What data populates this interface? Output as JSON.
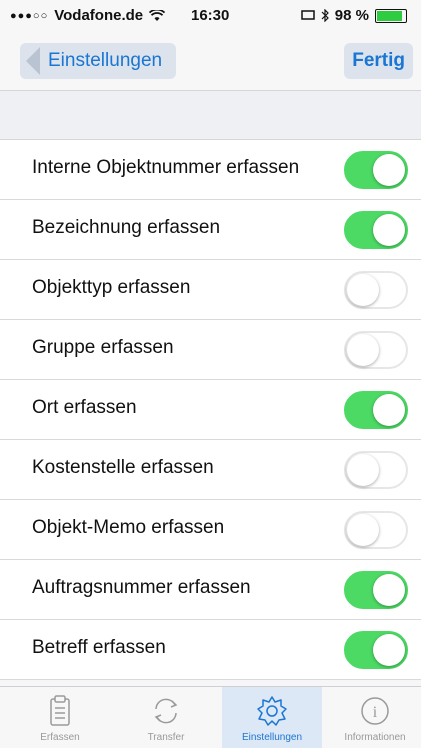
{
  "status_bar": {
    "signal": "●●●○○",
    "carrier": "Vodafone.de",
    "wifi_icon": "wifi-icon",
    "time": "16:30",
    "bluetooth_icon": "bluetooth-icon",
    "battery_percent_text": "98 %",
    "battery_level": 0.98
  },
  "nav": {
    "back_label": "Einstellungen",
    "done_label": "Fertig",
    "accent_color": "#1976d2"
  },
  "settings": [
    {
      "label": "Interne Objektnummer erfassen",
      "on": true
    },
    {
      "label": "Bezeichnung erfassen",
      "on": true
    },
    {
      "label": "Objekttyp erfassen",
      "on": false
    },
    {
      "label": "Gruppe erfassen",
      "on": false
    },
    {
      "label": "Ort erfassen",
      "on": true
    },
    {
      "label": "Kostenstelle erfassen",
      "on": false
    },
    {
      "label": "Objekt-Memo erfassen",
      "on": false
    },
    {
      "label": "Auftragsnummer erfassen",
      "on": true
    },
    {
      "label": "Betreff erfassen",
      "on": true
    }
  ],
  "toggle_on_color": "#4cd964",
  "tabs": [
    {
      "label": "Erfassen",
      "icon": "clipboard-icon",
      "active": false
    },
    {
      "label": "Transfer",
      "icon": "sync-icon",
      "active": false
    },
    {
      "label": "Einstellungen",
      "icon": "gear-icon",
      "active": true
    },
    {
      "label": "Informationen",
      "icon": "info-icon",
      "active": false
    }
  ]
}
